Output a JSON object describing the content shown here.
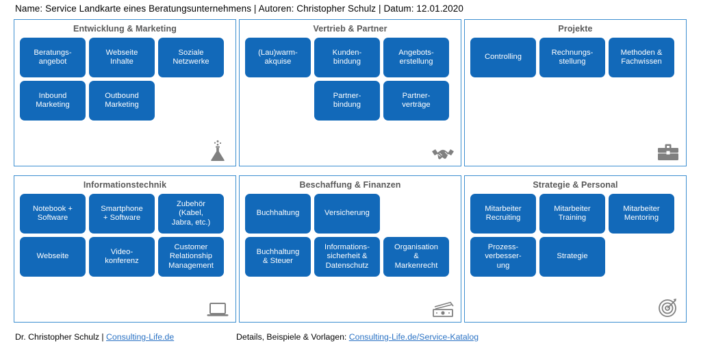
{
  "header": {
    "text": "Name: Service Landkarte eines Beratungsunternehmens | Autoren: Christopher Schulz | Datum: 12.01.2020"
  },
  "colors": {
    "card_blue": "#1269b9",
    "panel_border": "#3b8ed0",
    "title_gray": "#595959",
    "icon_gray": "#808080",
    "link_blue": "#2a72c4"
  },
  "panels": [
    {
      "title": "Entwicklung & Marketing",
      "icon": "flask-icon",
      "cards": [
        "Beratungs-\nangebot",
        "Webseite\nInhalte",
        "Soziale\nNetzwerke",
        "Inbound\nMarketing",
        "Outbound\nMarketing"
      ]
    },
    {
      "title": "Vertrieb & Partner",
      "icon": "handshake-icon",
      "cards": [
        "(Lau)warm-\nakquise",
        "Kunden-\nbindung",
        "Angebots-\nerstellung",
        "",
        "Partner-\nbindung",
        "Partner-\nverträge"
      ]
    },
    {
      "title": "Projekte",
      "icon": "briefcase-icon",
      "cards": [
        "Controlling",
        "Rechnungs-\nstellung",
        "Methoden &\nFachwissen"
      ]
    },
    {
      "title": "Informationstechnik",
      "icon": "laptop-icon",
      "cards": [
        "Notebook +\nSoftware",
        "Smartphone\n+ Software",
        "Zubehör\n(Kabel,\nJabra, etc.)",
        "Webseite",
        "Video-\nkonferenz",
        "Customer\nRelationship\nManagement"
      ]
    },
    {
      "title": "Beschaffung & Finanzen",
      "icon": "money-icon",
      "cards": [
        "Buchhaltung",
        "Versicherung",
        "",
        "Buchhaltung\n& Steuer",
        "Informations-\nsicherheit &\nDatenschutz",
        "Organisation\n&\nMarkenrecht"
      ]
    },
    {
      "title": "Strategie & Personal",
      "icon": "target-icon",
      "cards": [
        "Mitarbeiter\nRecruiting",
        "Mitarbeiter\nTraining",
        "Mitarbeiter\nMentoring",
        "Prozess-\nverbesser-\nung",
        "Strategie"
      ]
    }
  ],
  "footer": {
    "author_text": "Dr. Christopher Schulz | ",
    "author_link": "Consulting-Life.de",
    "details_text": "Details, Beispiele & Vorlagen: ",
    "details_link": "Consulting-Life.de/Service-Katalog"
  }
}
